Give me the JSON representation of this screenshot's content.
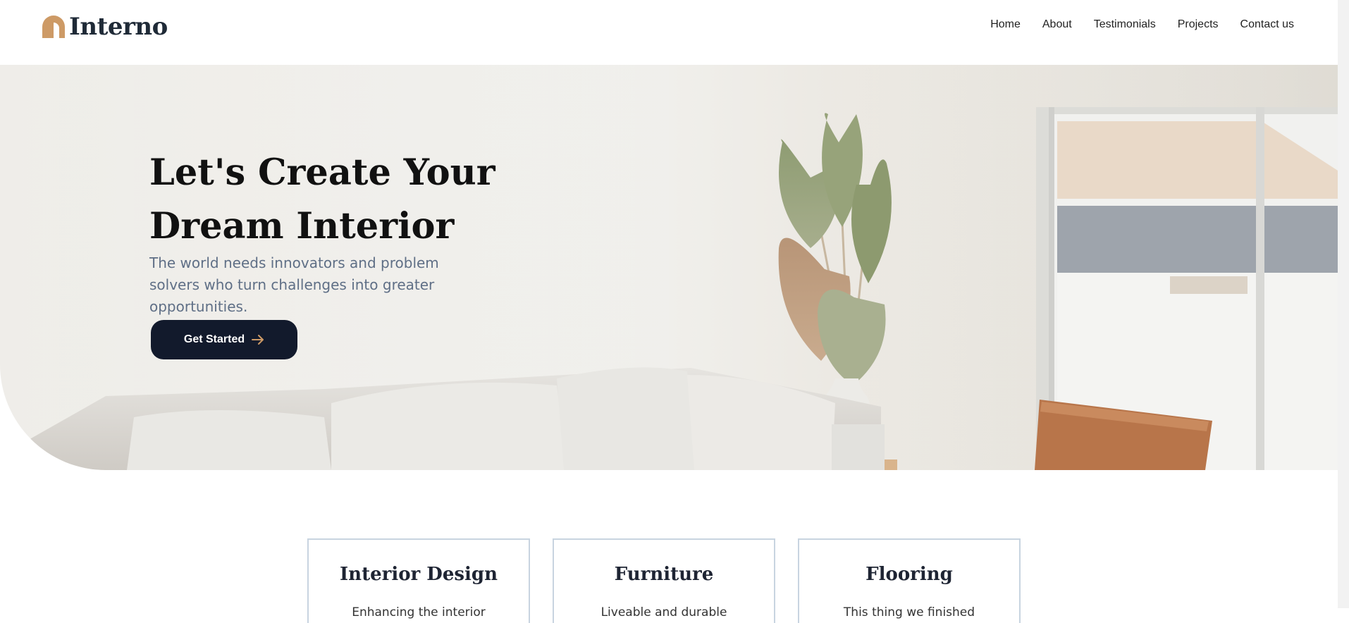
{
  "brand": {
    "name": "Interno",
    "accent_color": "#cd9a66"
  },
  "nav": {
    "items": [
      {
        "label": "Home"
      },
      {
        "label": "About"
      },
      {
        "label": "Testimonials"
      },
      {
        "label": "Projects"
      },
      {
        "label": "Contact us"
      }
    ]
  },
  "hero": {
    "title": "Let's Create Your Dream Interior",
    "subtitle": "The world needs innovators and problem solvers who turn challenges into greater opportunities.",
    "cta_label": "Get Started",
    "cta_icon": "arrow-right-icon",
    "cta_color": "#121a2c"
  },
  "services": [
    {
      "title": "Interior Design",
      "text": "Enhancing the interior"
    },
    {
      "title": "Furniture",
      "text": "Liveable and durable"
    },
    {
      "title": "Flooring",
      "text": "This thing we finished"
    }
  ]
}
